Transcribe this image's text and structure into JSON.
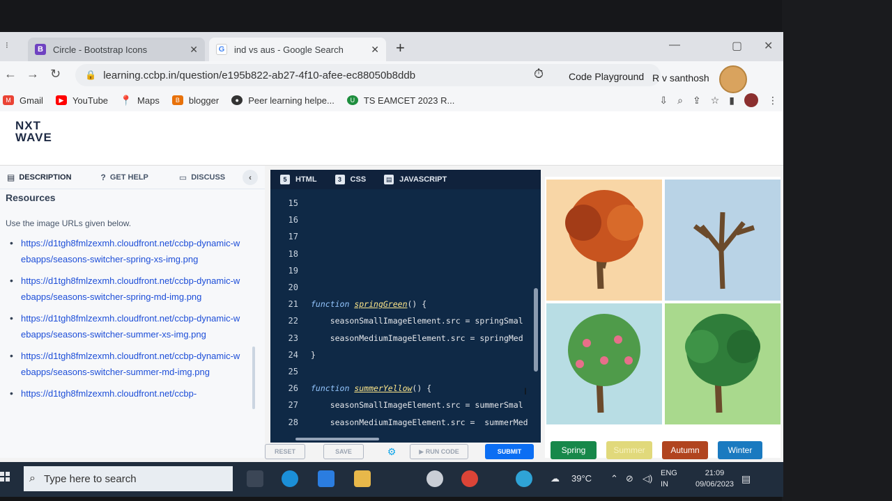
{
  "browser": {
    "tabs": [
      {
        "title": "Circle - Bootstrap Icons",
        "favicon": "B"
      },
      {
        "title": "ind vs aus - Google Search",
        "favicon": "G"
      }
    ],
    "close_glyph": "✕",
    "new_tab_glyph": "+",
    "url": "learning.ccbp.in/question/e195b822-ab27-4f10-afee-ec88050b8ddb",
    "bookmarks": [
      "Gmail",
      "YouTube",
      "Maps",
      "blogger",
      "Peer learning helpe...",
      "TS EAMCET 2023 R..."
    ]
  },
  "header": {
    "logo_line1": "NXT",
    "logo_line2": "WAVE",
    "playground_label": "Code Playground",
    "username": "R v santhosh"
  },
  "left": {
    "tabs": [
      "DESCRIPTION",
      "GET HELP",
      "DISCUSS"
    ],
    "resources_title": "Resources",
    "description": "Use the image URLs given below.",
    "links": [
      "https://d1tgh8fmlzexmh.cloudfront.net/ccbp-dynamic-webapps/seasons-switcher-spring-xs-img.png",
      "https://d1tgh8fmlzexmh.cloudfront.net/ccbp-dynamic-webapps/seasons-switcher-spring-md-img.png",
      "https://d1tgh8fmlzexmh.cloudfront.net/ccbp-dynamic-webapps/seasons-switcher-summer-xs-img.png",
      "https://d1tgh8fmlzexmh.cloudfront.net/ccbp-dynamic-webapps/seasons-switcher-summer-md-img.png",
      "https://d1tgh8fmlzexmh.cloudfront.net/ccbp-"
    ]
  },
  "editor": {
    "tabs": [
      "HTML",
      "CSS",
      "JAVASCRIPT"
    ],
    "lines": [
      {
        "n": "15",
        "code": ""
      },
      {
        "n": "16",
        "code": ""
      },
      {
        "n": "17",
        "code": ""
      },
      {
        "n": "18",
        "code": ""
      },
      {
        "n": "19",
        "code": ""
      },
      {
        "n": "20",
        "code": ""
      },
      {
        "n": "21",
        "kw": "function",
        "fn": "springGreen",
        "rest": "() {",
        "fold": "▾"
      },
      {
        "n": "22",
        "code": "    seasonSmallImageElement.src = springSmal"
      },
      {
        "n": "23",
        "code": "    seasonMediumImageElement.src = springMed"
      },
      {
        "n": "24",
        "code": "}"
      },
      {
        "n": "25",
        "code": ""
      },
      {
        "n": "26",
        "kw": "function",
        "fn": "summerYellow",
        "rest": "() {",
        "fold": "▾"
      },
      {
        "n": "27",
        "code": "    seasonSmallImageElement.src = summerSmal"
      },
      {
        "n": "28",
        "code": "    seasonMediumImageElement.src =  summerMed"
      }
    ]
  },
  "actions": {
    "reset": "RESET",
    "save": "SAVE",
    "run": "▶ RUN CODE",
    "submit": "SUBMIT"
  },
  "seasons": [
    "Spring",
    "Summer",
    "Autumn",
    "Winter"
  ],
  "taskbar": {
    "search_placeholder": "Type here to search",
    "temperature": "39°C",
    "lang_line1": "ENG",
    "lang_line2": "IN",
    "time": "21:09",
    "date": "09/06/2023"
  },
  "colors": {
    "editor_bg": "#0f2946",
    "submit": "#0b6ef3",
    "spring": "#17884a",
    "summer": "#e1d97b",
    "autumn": "#b1441f",
    "winter": "#1a7ac0"
  }
}
